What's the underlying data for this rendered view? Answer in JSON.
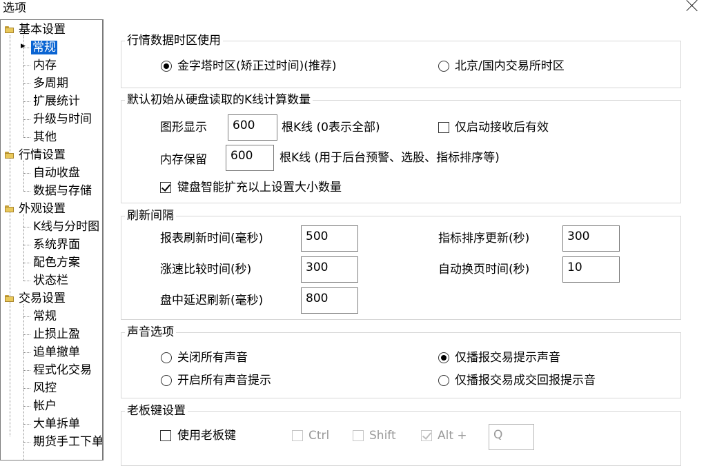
{
  "window": {
    "title": "选项"
  },
  "tree": {
    "groups": [
      {
        "label": "基本设置",
        "items": [
          "常规",
          "内存",
          "多周期",
          "扩展统计",
          "升级与时间",
          "其他"
        ]
      },
      {
        "label": "行情设置",
        "items": [
          "自动收盘",
          "数据与存储"
        ]
      },
      {
        "label": "外观设置",
        "items": [
          "K线与分时图",
          "系统界面",
          "配色方案",
          "状态栏"
        ]
      },
      {
        "label": "交易设置",
        "items": [
          "常规",
          "止损止盈",
          "追单撤单",
          "程式化交易",
          "风控",
          "帐户",
          "大单拆单",
          "期货手工下单"
        ]
      }
    ],
    "selected": "常规"
  },
  "timezone": {
    "legend": "行情数据时区使用",
    "option1": "金字塔时区(矫正过时间)(推荐)",
    "option2": "北京/国内交易所时区",
    "selected": 1
  },
  "kline": {
    "legend": "默认初始从硬盘读取的K线计算数量",
    "graph_label": "图形显示",
    "graph_value": "600",
    "graph_unit": "根K线 (0表示全部)",
    "startup_only": "仅启动接收后有效",
    "startup_only_checked": false,
    "mem_label": "内存保留",
    "mem_value": "600",
    "mem_unit": "根K线  (用于后台预警、选股、指标排序等)",
    "auto_expand": "键盘智能扩充以上设置大小数量",
    "auto_expand_checked": true
  },
  "refresh": {
    "legend": "刷新间隔",
    "report_label": "报表刷新时间(毫秒)",
    "report_value": "500",
    "speed_label": "涨速比较时间(秒)",
    "speed_value": "300",
    "delay_label": "盘中延迟刷新(毫秒)",
    "delay_value": "800",
    "sort_label": "指标排序更新(秒)",
    "sort_value": "300",
    "page_label": "自动换页时间(秒)",
    "page_value": "10"
  },
  "sound": {
    "legend": "声音选项",
    "off_all": "关闭所有声音",
    "on_all": "开启所有声音提示",
    "trade_only": "仅播报交易提示声音",
    "trade_fill_only": "仅播报交易成交回报提示音",
    "selected": "trade_only"
  },
  "boss": {
    "legend": "老板键设置",
    "use_label": "使用老板键",
    "use_checked": false,
    "ctrl": "Ctrl",
    "shift": "Shift",
    "alt": "Alt +",
    "alt_checked": true,
    "key_value": "Q"
  }
}
